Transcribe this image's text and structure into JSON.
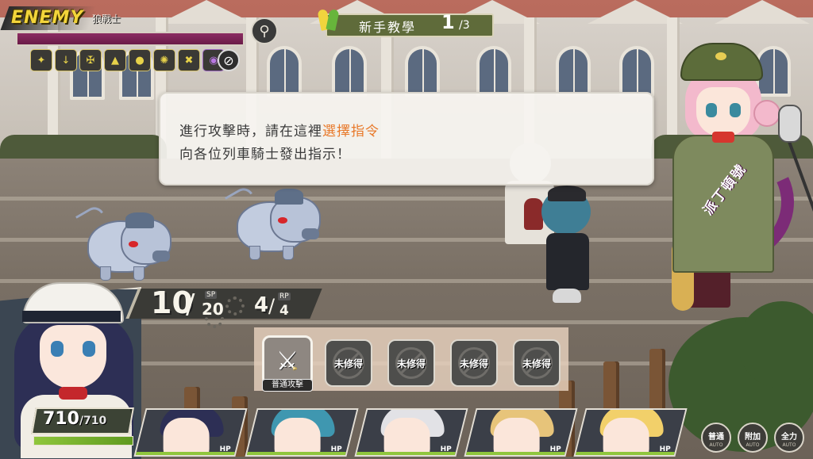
{
  "enemy": {
    "logo": "ENEMY",
    "name": "狼戰士",
    "status_icons": [
      "feather-icon",
      "sword-down-icon",
      "claw-icon",
      "flame-icon",
      "drop-icon",
      "swirl-icon",
      "cross-icon",
      "poison-icon"
    ],
    "hp_fraction": 1.0
  },
  "tutorial": {
    "title": "新手教學",
    "current": "1",
    "total": "/3"
  },
  "dialog": {
    "line1_prefix": "進行攻擊時，請在這裡",
    "line1_highlight": "選擇指令",
    "line2": "向各位列車騎士發出指示！"
  },
  "navigator": {
    "name": "派丁頓號"
  },
  "active_character": {
    "hp_current": "710",
    "hp_max": "/710",
    "hp_fraction": 1.0
  },
  "resources": {
    "sp_current": "10",
    "sp_slash": "/",
    "sp_max": "20",
    "sp_tag": "SP",
    "rp_current": "4",
    "rp_slash": "/",
    "rp_max": "4",
    "rp_tag": "RP"
  },
  "commands": [
    {
      "label": "普通攻擊",
      "icon": "sword-icon",
      "active": true
    },
    {
      "label": "未修得",
      "icon": "locked-icon",
      "active": false
    },
    {
      "label": "未修得",
      "icon": "locked-icon",
      "active": false
    },
    {
      "label": "未修得",
      "icon": "locked-icon",
      "active": false
    },
    {
      "label": "未修得",
      "icon": "locked-icon",
      "active": false
    }
  ],
  "party": [
    {
      "hp_label": "HP"
    },
    {
      "hp_label": "HP"
    },
    {
      "hp_label": "HP"
    },
    {
      "hp_label": "HP"
    },
    {
      "hp_label": "HP"
    }
  ],
  "controls": [
    {
      "label": "普通",
      "sub": "AUTO"
    },
    {
      "label": "附加",
      "sub": "AUTO"
    },
    {
      "label": "全力",
      "sub": "AUTO"
    }
  ],
  "colors": {
    "highlight": "#e8792a",
    "enemy_hp": "#8c2c62",
    "navigator_ring": "#7c2b77",
    "tutorial_banner": "#5f6b3a"
  }
}
